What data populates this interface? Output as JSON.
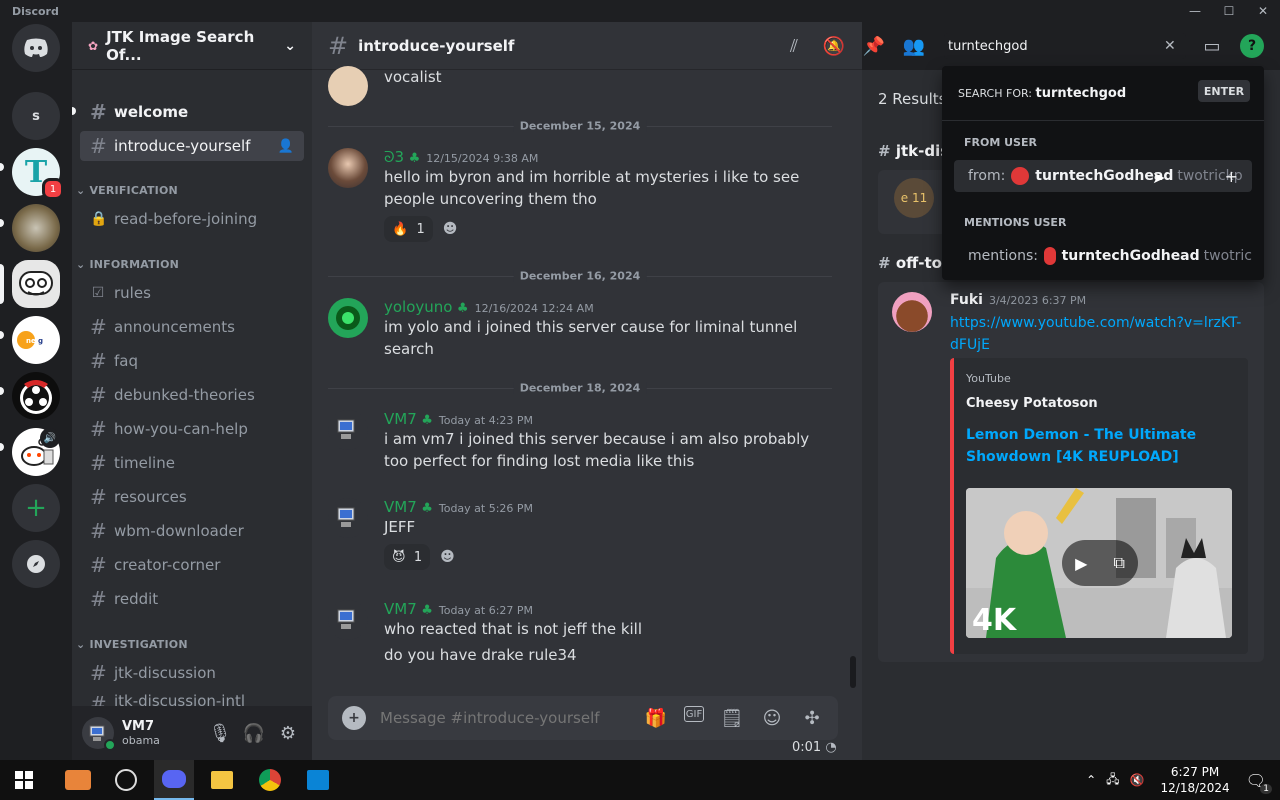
{
  "app": {
    "brand": "Discord"
  },
  "guilds": {
    "s_label": "s",
    "badge": "1"
  },
  "server": {
    "name": "JTK Image Search Of..."
  },
  "channels": {
    "welcome": "welcome",
    "introduce": "introduce-yourself",
    "cat_verification": "VERIFICATION",
    "read_before": "read-before-joining",
    "cat_information": "INFORMATION",
    "rules": "rules",
    "announcements": "announcements",
    "faq": "faq",
    "debunked": "debunked-theories",
    "howhelp": "how-you-can-help",
    "timeline": "timeline",
    "resources": "resources",
    "wbm": "wbm-downloader",
    "creator": "creator-corner",
    "reddit": "reddit",
    "cat_investigation": "INVESTIGATION",
    "jtk": "jtk-discussion",
    "jtk_intl": "jtk-discussion-intl"
  },
  "user": {
    "name": "VM7",
    "status": "obama"
  },
  "chat": {
    "channel": "introduce-yourself",
    "first_text": "vocalist",
    "date1": "December 15, 2024",
    "date2": "December 16, 2024",
    "date3": "December 18, 2024",
    "m1": {
      "name": "ᘐ3",
      "ts": "12/15/2024 9:38 AM",
      "text": "hello im byron and im horrible at mysteries i like to see people uncovering them tho",
      "react": "1"
    },
    "m2": {
      "name": "yoloyuno",
      "ts": "12/16/2024 12:24 AM",
      "text": "im yolo and i joined this server cause for liminal tunnel search"
    },
    "m3": {
      "name": "VM7",
      "ts": "Today at 4:23 PM",
      "text": "i am vm7 i joined this server because i am also probably too perfect for finding lost media like this"
    },
    "m4": {
      "name": "VM7",
      "ts": "Today at 5:26 PM",
      "text": "JEFF",
      "react": "1"
    },
    "m5": {
      "name": "VM7",
      "ts": "Today at 6:27 PM",
      "text1": "who reacted that is not jeff the kill",
      "text2": "do you have drake rule34"
    },
    "placeholder": "Message #introduce-yourself",
    "timer": "0:01"
  },
  "search": {
    "query": "turntechgod",
    "search_for_label": "SEARCH FOR:",
    "search_for_value": "turntechgod",
    "enter": "ENTER",
    "from_header": "FROM USER",
    "from_prefix": "from:",
    "from_name": "turntechGodhead",
    "from_alias": "twotrickp",
    "mentions_header": "MENTIONS USER",
    "mentions_prefix": "mentions:",
    "mentions_name": "turntechGodhead",
    "mentions_alias": "twotric"
  },
  "results": {
    "count": "2 Results",
    "ch1": "jtk-disc",
    "ch1_thumb": "e 11",
    "ch2": "off-top",
    "author": "Fuki",
    "ts": "3/4/2023 6:37 PM",
    "link": "https://www.youtube.com/watch?v=lrzKT-dFUjE",
    "embed_provider": "YouTube",
    "embed_author": "Cheesy Potatoson",
    "embed_title": "Lemon Demon - The Ultimate Showdown [4K REUPLOAD]",
    "thumb_label": "4K"
  },
  "taskbar": {
    "time": "6:27 PM",
    "date": "12/18/2024",
    "notif": "1"
  },
  "colors": {
    "accent": "#5865f2",
    "green": "#23a559",
    "link": "#00a8fc",
    "red": "#f23f43"
  }
}
